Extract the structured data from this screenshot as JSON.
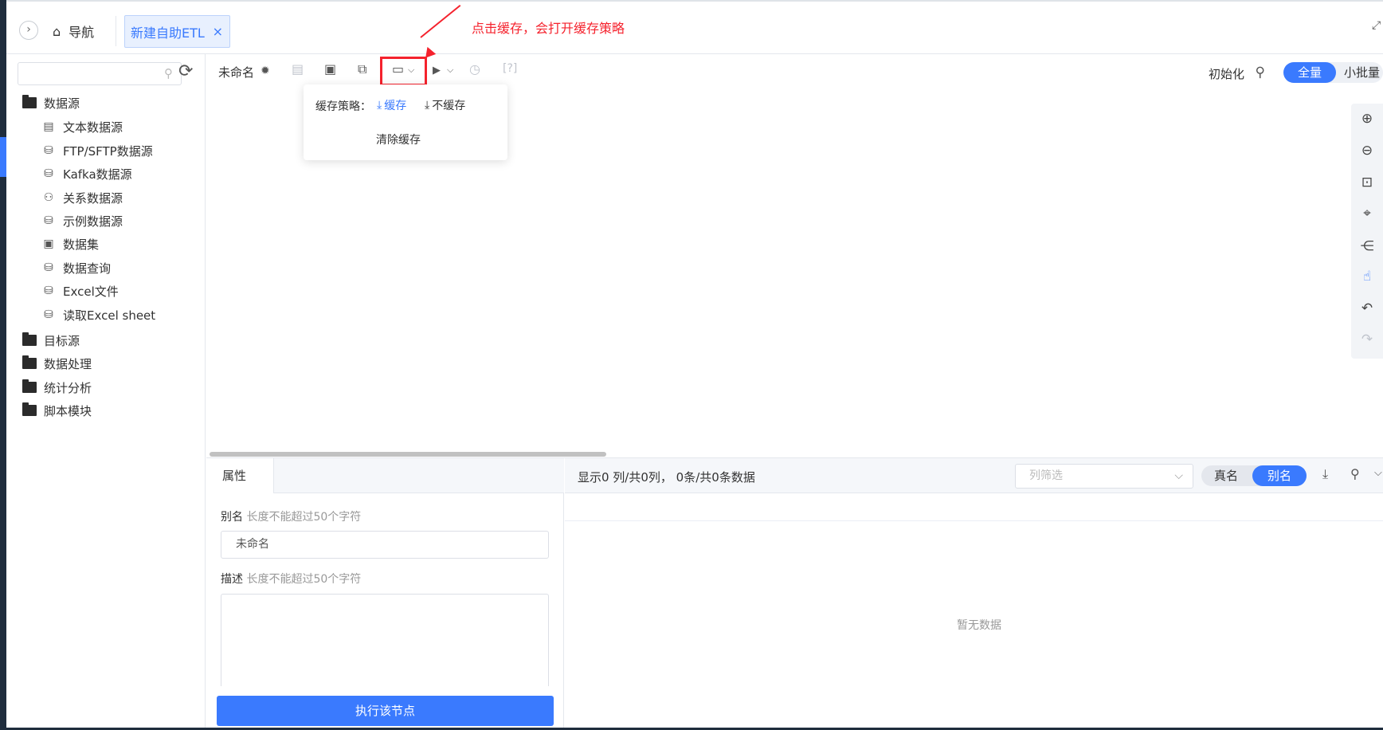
{
  "nav": {
    "expand_icon": "chevron-right-icon",
    "home_label": "导航",
    "home_icon": "home-icon"
  },
  "tab": {
    "label": "新建自助ETL",
    "close": "×"
  },
  "sidebar": {
    "search_placeholder": "",
    "items": [
      {
        "label": "数据源",
        "type": "folder-open",
        "icon": "folder-open-icon"
      },
      {
        "label": "文本数据源",
        "type": "child",
        "icon": "text-file-icon"
      },
      {
        "label": "FTP/SFTP数据源",
        "type": "child",
        "icon": "database-icon"
      },
      {
        "label": "Kafka数据源",
        "type": "child",
        "icon": "database-icon"
      },
      {
        "label": "关系数据源",
        "type": "child",
        "icon": "relation-icon"
      },
      {
        "label": "示例数据源",
        "type": "child",
        "icon": "database-icon"
      },
      {
        "label": "数据集",
        "type": "child",
        "icon": "dataset-icon"
      },
      {
        "label": "数据查询",
        "type": "child",
        "icon": "database-icon"
      },
      {
        "label": "Excel文件",
        "type": "child",
        "icon": "database-icon"
      },
      {
        "label": "读取Excel sheet",
        "type": "child",
        "icon": "database-icon"
      },
      {
        "label": "目标源",
        "type": "folder",
        "icon": "folder-icon"
      },
      {
        "label": "数据处理",
        "type": "folder",
        "icon": "folder-icon"
      },
      {
        "label": "统计分析",
        "type": "folder",
        "icon": "folder-icon"
      },
      {
        "label": "脚本模块",
        "type": "folder",
        "icon": "folder-icon"
      }
    ]
  },
  "toolbar": {
    "name": "未命名",
    "init_label": "初始化",
    "mode_full": "全量",
    "mode_batch": "小批量"
  },
  "annotation": {
    "text": "点击缓存，会打开缓存策略",
    "color": "#f5222d"
  },
  "cache_popover": {
    "label": "缓存策略：",
    "option_cache": "缓存",
    "option_nocache": "不缓存",
    "selected": "缓存",
    "clear": "清除缓存"
  },
  "properties": {
    "tab": "属性",
    "alias_label": "别名",
    "alias_hint": "长度不能超过50个字符",
    "alias_value": "未命名",
    "desc_label": "描述",
    "desc_hint": "长度不能超过50个字符",
    "run_button": "执行该节点"
  },
  "preview": {
    "summary": "显示0 列/共0列， 0条/共0条数据",
    "filter_placeholder": "列筛选",
    "real_name": "真名",
    "alias_name": "别名",
    "selected_name_mode": "别名",
    "empty_text": "暂无数据"
  },
  "colors": {
    "accent": "#3a7afe",
    "sidebar_dark": "#1f2d3d"
  }
}
